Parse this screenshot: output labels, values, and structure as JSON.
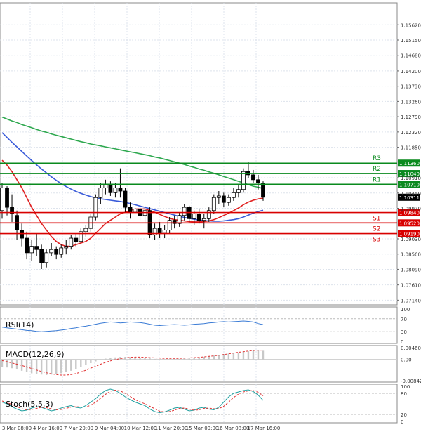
{
  "chart_data": [
    {
      "type": "candlestick",
      "panel": "price",
      "y_ticks": [
        "1.15620",
        "1.15150",
        "1.14680",
        "1.14200",
        "1.13730",
        "1.13260",
        "1.12790",
        "1.12320",
        "1.11850",
        "1.10910",
        "1.10440",
        "1.09970",
        "1.09030",
        "1.08560",
        "1.08090",
        "1.07610",
        "1.07140"
      ],
      "ylim": [
        1.0704,
        1.1595
      ],
      "x_ticks": [
        "3 Mar 08:00",
        "4 Mar 16:00",
        "7 Mar 20:00",
        "9 Mar 04:00",
        "10 Mar 12:00",
        "11 Mar 20:00",
        "15 Mar 00:00",
        "16 Mar 08:00",
        "17 Mar 16:00"
      ],
      "grid": true,
      "candles": [
        [
          1.099,
          1.1075,
          1.0965,
          1.106
        ],
        [
          1.106,
          1.1065,
          1.0975,
          1.1
        ],
        [
          1.1,
          1.104,
          1.0955,
          1.098
        ],
        [
          1.0975,
          1.099,
          1.09,
          1.093
        ],
        [
          1.093,
          1.095,
          1.088,
          1.0905
        ],
        [
          1.0905,
          1.0925,
          1.084,
          1.086
        ],
        [
          1.086,
          1.09,
          1.0835,
          1.088
        ],
        [
          1.088,
          1.092,
          1.085,
          1.087
        ],
        [
          1.087,
          1.0885,
          1.081,
          1.083
        ],
        [
          1.083,
          1.087,
          1.0815,
          1.086
        ],
        [
          1.086,
          1.089,
          1.085,
          1.087
        ],
        [
          1.087,
          1.088,
          1.084,
          1.0855
        ],
        [
          1.0855,
          1.0885,
          1.0845,
          1.0875
        ],
        [
          1.0875,
          1.09,
          1.0855,
          1.088
        ],
        [
          1.088,
          1.0915,
          1.087,
          1.0905
        ],
        [
          1.0905,
          1.092,
          1.088,
          1.0895
        ],
        [
          1.0895,
          1.0935,
          1.089,
          1.0925
        ],
        [
          1.0925,
          1.0945,
          1.091,
          1.0935
        ],
        [
          1.0935,
          1.098,
          1.0925,
          1.097
        ],
        [
          1.097,
          1.104,
          1.096,
          1.103
        ],
        [
          1.103,
          1.1075,
          1.101,
          1.106
        ],
        [
          1.106,
          1.1085,
          1.104,
          1.107
        ],
        [
          1.107,
          1.108,
          1.1035,
          1.1045
        ],
        [
          1.1045,
          1.1075,
          1.103,
          1.106
        ],
        [
          1.106,
          1.112,
          1.103,
          1.105
        ],
        [
          1.105,
          1.106,
          1.0985,
          1.1
        ],
        [
          1.1,
          1.1015,
          1.0965,
          1.0985
        ],
        [
          1.0985,
          1.101,
          1.096,
          1.0995
        ],
        [
          1.0995,
          1.101,
          1.096,
          1.0975
        ],
        [
          1.0975,
          1.1005,
          1.095,
          1.099
        ],
        [
          1.099,
          1.1,
          1.0905,
          1.0915
        ],
        [
          1.0915,
          1.095,
          1.09,
          1.0935
        ],
        [
          1.0935,
          1.0955,
          1.0905,
          1.092
        ],
        [
          1.092,
          1.0945,
          1.0905,
          1.093
        ],
        [
          1.093,
          1.097,
          1.092,
          1.096
        ],
        [
          1.096,
          1.0975,
          1.0935,
          1.095
        ],
        [
          1.095,
          1.0985,
          1.094,
          1.0975
        ],
        [
          1.0975,
          1.101,
          1.096,
          1.1
        ],
        [
          1.1,
          1.1005,
          1.0955,
          1.0965
        ],
        [
          1.0965,
          1.099,
          1.0945,
          1.098
        ],
        [
          1.098,
          1.0995,
          1.095,
          1.096
        ],
        [
          1.096,
          1.098,
          1.0935,
          1.0965
        ],
        [
          1.0965,
          1.1,
          1.0955,
          1.099
        ],
        [
          1.099,
          1.104,
          1.098,
          1.103
        ],
        [
          1.103,
          1.105,
          1.101,
          1.1035
        ],
        [
          1.1035,
          1.1045,
          1.1,
          1.1015
        ],
        [
          1.1015,
          1.104,
          1.1005,
          1.103
        ],
        [
          1.103,
          1.106,
          1.102,
          1.1045
        ],
        [
          1.1045,
          1.107,
          1.103,
          1.1055
        ],
        [
          1.1055,
          1.112,
          1.1045,
          1.111
        ],
        [
          1.111,
          1.114,
          1.109,
          1.11
        ],
        [
          1.11,
          1.1115,
          1.1075,
          1.1085
        ],
        [
          1.1085,
          1.11,
          1.1055,
          1.1075
        ],
        [
          1.1075,
          1.108,
          1.102,
          1.1031
        ]
      ],
      "moving_averages": [
        {
          "color": "#2ea84f",
          "values": [
            1.1278,
            1.1272,
            1.1266,
            1.1261,
            1.1255,
            1.125,
            1.1245,
            1.124,
            1.1235,
            1.1231,
            1.1226,
            1.1222,
            1.1218,
            1.1214,
            1.121,
            1.1206,
            1.1202,
            1.1199,
            1.1195,
            1.1192,
            1.1189,
            1.1186,
            1.1183,
            1.118,
            1.1177,
            1.1174,
            1.1171,
            1.1168,
            1.1165,
            1.1162,
            1.1159,
            1.1155,
            1.1152,
            1.1148,
            1.1144,
            1.114,
            1.1136,
            1.1132,
            1.1127,
            1.1123,
            1.1118,
            1.1114,
            1.1109,
            1.1105,
            1.11,
            1.1095,
            1.109,
            1.1085,
            1.108,
            1.1075,
            1.107,
            1.1065,
            1.1062,
            1.1058
          ]
        },
        {
          "color": "#3a5bd9",
          "values": [
            1.123,
            1.1215,
            1.12,
            1.1186,
            1.1172,
            1.1158,
            1.1144,
            1.1131,
            1.1118,
            1.1106,
            1.1094,
            1.1083,
            1.1073,
            1.1064,
            1.1056,
            1.1049,
            1.1043,
            1.1038,
            1.1033,
            1.1029,
            1.1026,
            1.1024,
            1.1022,
            1.102,
            1.1018,
            1.1015,
            1.1012,
            1.1008,
            1.1004,
            1.1,
            1.0996,
            1.0992,
            1.0988,
            1.0984,
            1.098,
            1.0976,
            1.0972,
            1.0969,
            1.0966,
            1.0963,
            1.0961,
            1.0959,
            1.0958,
            1.0957,
            1.0957,
            1.0958,
            1.096,
            1.0962,
            1.0965,
            1.097,
            1.0976,
            1.0982,
            1.0987,
            1.0991
          ]
        },
        {
          "color": "#e02020",
          "values": [
            1.1145,
            1.113,
            1.111,
            1.1085,
            1.106,
            1.103,
            1.1,
            1.0975,
            1.095,
            1.093,
            1.091,
            1.0895,
            1.0885,
            1.088,
            1.088,
            1.0885,
            1.089,
            1.0895,
            1.0905,
            1.092,
            1.0935,
            1.095,
            1.096,
            1.097,
            1.098,
            1.0985,
            1.099,
            1.0995,
            1.0995,
            1.0995,
            1.099,
            1.0985,
            1.0978,
            1.0972,
            1.0966,
            1.0962,
            1.096,
            1.0958,
            1.0956,
            1.0955,
            1.0955,
            1.0956,
            1.0958,
            1.0962,
            1.0968,
            1.0975,
            1.0982,
            1.099,
            1.0998,
            1.1008,
            1.1016,
            1.1022,
            1.1026,
            1.1028
          ]
        }
      ],
      "levels": [
        {
          "name": "R3",
          "value": 1.1136,
          "label": "1.11360",
          "color": "#0a8a1e"
        },
        {
          "name": "R2",
          "value": 1.1104,
          "label": "1.11040",
          "color": "#0a8a1e"
        },
        {
          "name": "R1",
          "value": 1.1071,
          "label": "1.10710",
          "color": "#0a8a1e"
        },
        {
          "name": "S1",
          "value": 1.0984,
          "label": "1.09840",
          "color": "#d80000"
        },
        {
          "name": "S2",
          "value": 1.0952,
          "label": "1.09520",
          "color": "#d80000"
        },
        {
          "name": "S3",
          "value": 1.0919,
          "label": "1.09190",
          "color": "#d80000"
        }
      ],
      "current_price": {
        "value": 1.1031,
        "label": "1.10311"
      }
    },
    {
      "type": "line",
      "panel": "rsi",
      "title": "RSI(14)",
      "ylim": [
        0,
        100
      ],
      "y_ticks": [
        "100",
        "70",
        "30",
        "0"
      ],
      "levels": [
        70,
        30
      ],
      "color": "#3a7bd5",
      "values": [
        44,
        42,
        40,
        38,
        36,
        34,
        33,
        31,
        30,
        31,
        32,
        33,
        35,
        37,
        40,
        42,
        45,
        47,
        50,
        53,
        56,
        58,
        60,
        59,
        57,
        58,
        60,
        59,
        58,
        56,
        53,
        50,
        49,
        50,
        51,
        52,
        51,
        50,
        51,
        53,
        54,
        55,
        57,
        58,
        60,
        61,
        60,
        61,
        62,
        63,
        62,
        60,
        55,
        52
      ]
    },
    {
      "type": "bar",
      "panel": "macd",
      "title": "MACD(12,26,9)",
      "y_ticks": [
        "0.004608",
        "0.00",
        "-0.008426"
      ],
      "ylim": [
        -0.008426,
        0.004608
      ],
      "histogram": [
        -0.003,
        -0.0032,
        -0.0035,
        -0.004,
        -0.0045,
        -0.005,
        -0.0055,
        -0.0058,
        -0.006,
        -0.0062,
        -0.006,
        -0.0058,
        -0.0055,
        -0.005,
        -0.0045,
        -0.0038,
        -0.003,
        -0.0022,
        -0.0015,
        -0.0008,
        -0.0002,
        0.0003,
        0.0006,
        0.0008,
        0.001,
        0.001,
        0.0009,
        0.0008,
        0.0007,
        0.0006,
        0.0004,
        0.0002,
        0.0001,
        0.0,
        0.0,
        0.0001,
        0.0002,
        0.0003,
        0.0004,
        0.0006,
        0.0008,
        0.001,
        0.0012,
        0.0015,
        0.0018,
        0.0021,
        0.0023,
        0.0025,
        0.0027,
        0.003,
        0.0032,
        0.0034,
        0.0035,
        0.0034
      ],
      "signal": [
        -0.0005,
        -0.0009,
        -0.0014,
        -0.0019,
        -0.0024,
        -0.003,
        -0.0036,
        -0.0042,
        -0.0048,
        -0.0053,
        -0.0057,
        -0.006,
        -0.0062,
        -0.0062,
        -0.006,
        -0.0056,
        -0.005,
        -0.0043,
        -0.0035,
        -0.0027,
        -0.0019,
        -0.0012,
        -0.0006,
        -0.0001,
        0.0003,
        0.0006,
        0.0008,
        0.0009,
        0.0009,
        0.0008,
        0.0007,
        0.0006,
        0.0005,
        0.0004,
        0.0004,
        0.0004,
        0.0004,
        0.0005,
        0.0006,
        0.0007,
        0.0008,
        0.001,
        0.0012,
        0.0014,
        0.0016,
        0.0019,
        0.0022,
        0.0025,
        0.0028,
        0.003,
        0.0033,
        0.0035,
        0.0036,
        0.0036
      ]
    },
    {
      "type": "line",
      "panel": "stoch",
      "title": "Stoch(5,5,3)",
      "ylim": [
        0,
        100
      ],
      "y_ticks": [
        "100",
        "80",
        "20",
        "0"
      ],
      "levels": [
        80,
        20
      ],
      "main": {
        "color": "#20a0a0",
        "values": [
          55,
          50,
          42,
          35,
          30,
          32,
          38,
          42,
          40,
          35,
          30,
          33,
          38,
          42,
          45,
          40,
          38,
          45,
          55,
          65,
          78,
          88,
          92,
          88,
          80,
          70,
          62,
          55,
          50,
          45,
          35,
          28,
          25,
          27,
          32,
          38,
          40,
          35,
          30,
          32,
          38,
          40,
          35,
          33,
          40,
          55,
          70,
          80,
          84,
          88,
          90,
          85,
          75,
          60
        ]
      },
      "signal": {
        "color": "#e03030",
        "values": [
          58,
          54,
          48,
          42,
          36,
          33,
          34,
          37,
          40,
          39,
          36,
          33,
          34,
          37,
          41,
          42,
          41,
          41,
          46,
          55,
          66,
          77,
          86,
          89,
          87,
          80,
          71,
          62,
          56,
          50,
          43,
          36,
          29,
          27,
          28,
          32,
          37,
          38,
          35,
          32,
          33,
          37,
          38,
          36,
          36,
          43,
          55,
          68,
          78,
          84,
          87,
          88,
          83,
          73
        ]
      }
    }
  ]
}
